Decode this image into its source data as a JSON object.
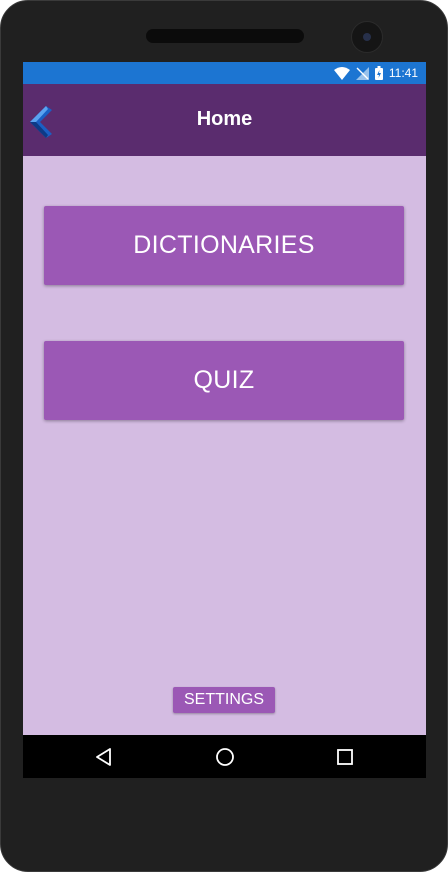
{
  "status_bar": {
    "time": "11:41",
    "icons": [
      "wifi-icon",
      "no-signal-icon",
      "battery-icon"
    ]
  },
  "app_bar": {
    "title": "Home",
    "back_icon": "back-arrow-icon"
  },
  "main": {
    "buttons": [
      {
        "label": "DICTIONARIES"
      },
      {
        "label": "QUIZ"
      }
    ],
    "settings_label": "SETTINGS"
  },
  "nav_bar": {
    "items": [
      "back-triangle-icon",
      "home-circle-icon",
      "recents-square-icon"
    ]
  },
  "colors": {
    "status_bar": "#1c75d2",
    "app_bar": "#5a2c6e",
    "background": "#d4bce2",
    "button": "#9b58b5"
  }
}
